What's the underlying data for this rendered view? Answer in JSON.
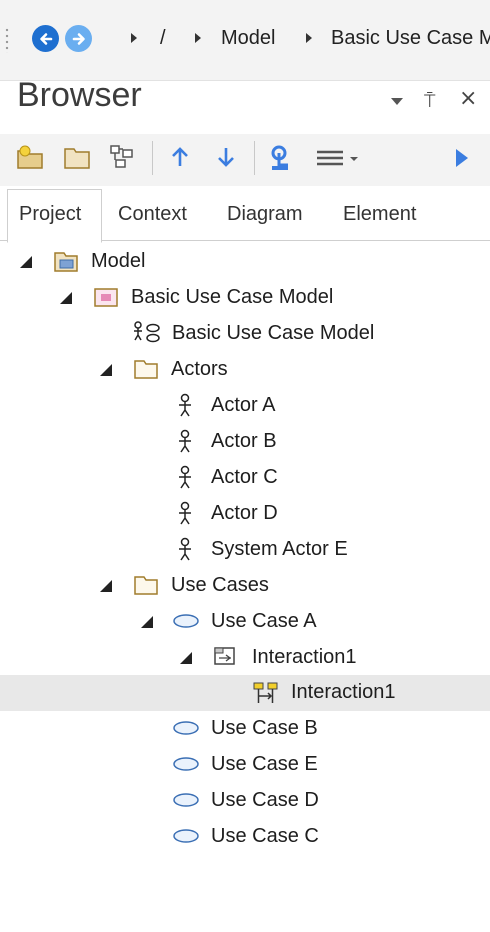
{
  "breadcrumb": {
    "items": [
      "/",
      "Model",
      "Basic Use Case M"
    ]
  },
  "browser": {
    "title": "Browser",
    "pin_glyph": "⍑",
    "close_glyph": "×"
  },
  "toolbar": {
    "icons": [
      "new-package-icon",
      "folder-icon",
      "diagram-icon",
      "move-up-icon",
      "move-down-icon",
      "locate-icon",
      "menu-icon",
      "run-icon"
    ]
  },
  "tabs": [
    "Project",
    "Context",
    "Diagram",
    "Element"
  ],
  "tree": {
    "model": "Model",
    "basic_package": "Basic Use Case Model",
    "basic_diagram": "Basic Use Case Model",
    "actors_folder": "Actors",
    "actors": [
      "Actor A",
      "Actor B",
      "Actor C",
      "Actor D",
      "System Actor E"
    ],
    "use_cases_folder": "Use Cases",
    "use_case_a": "Use Case A",
    "interaction_parent": "Interaction1",
    "interaction_child": "Interaction1",
    "other_use_cases": [
      "Use Case B",
      "Use Case E",
      "Use Case D",
      "Use Case C"
    ]
  },
  "colors": {
    "nav_back": "#1e6fd0",
    "nav_forward": "#6aaef0",
    "folder": "#c9a45c",
    "selection": "#e8e8e8",
    "accent": "#3b7de0"
  }
}
